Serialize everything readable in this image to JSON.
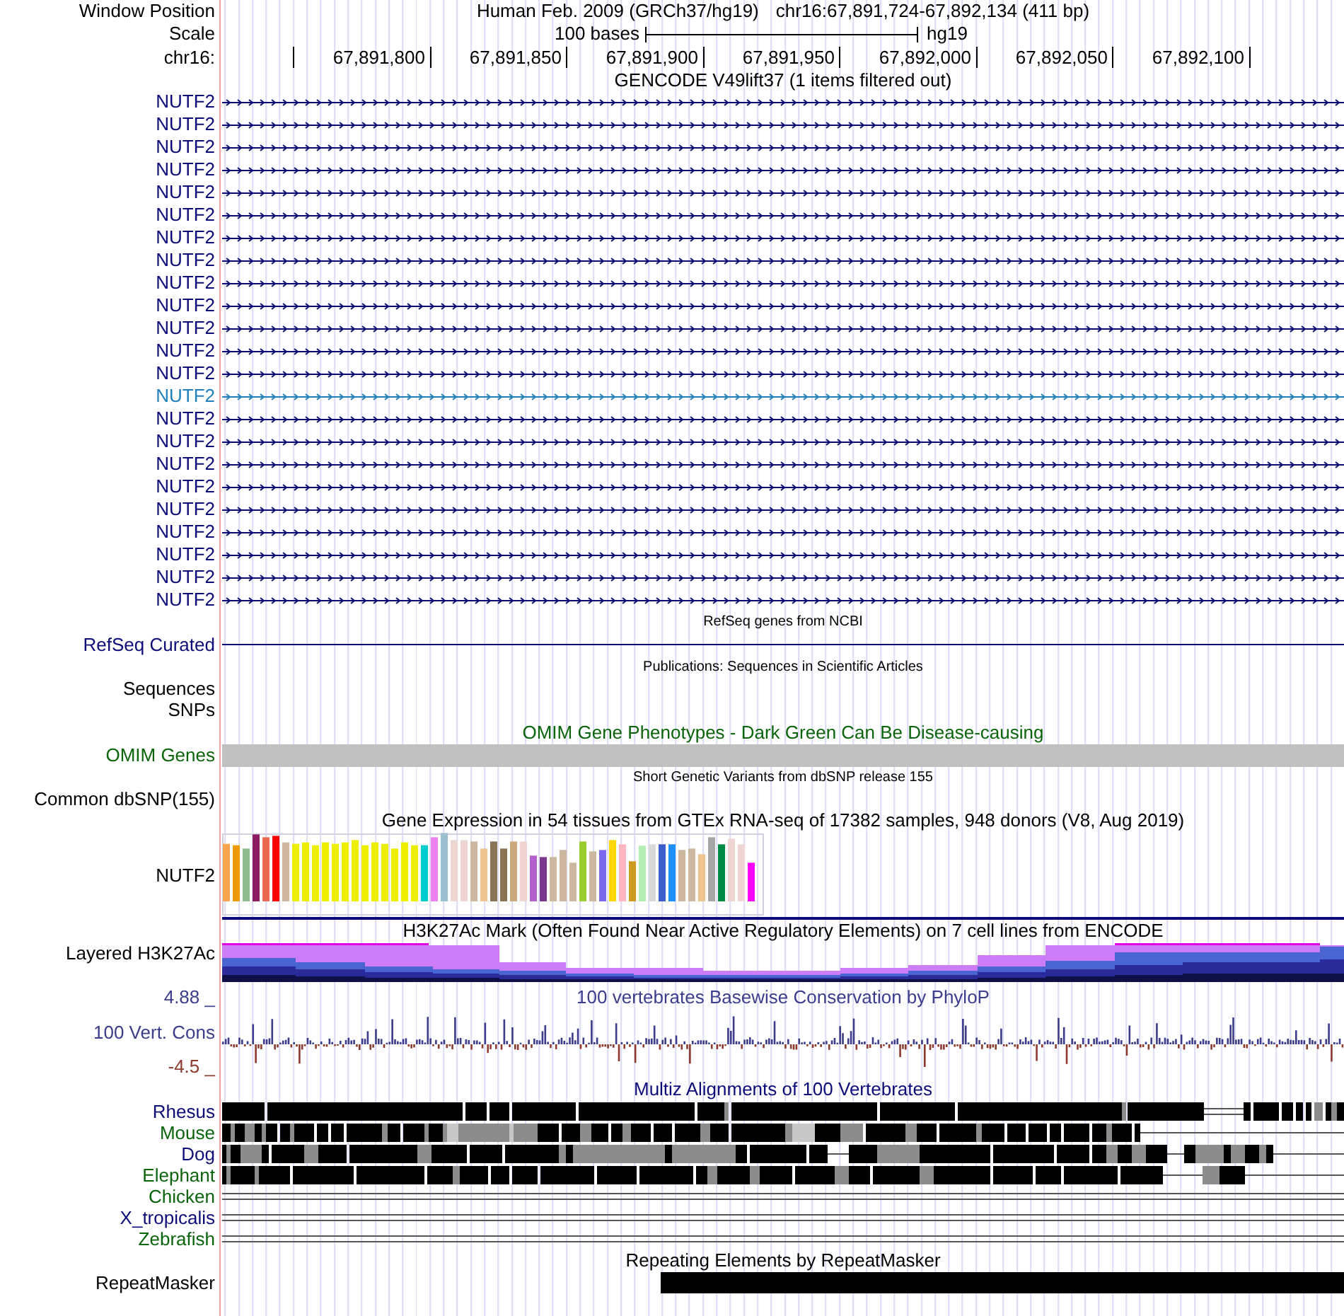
{
  "window_position": {
    "label": "Window Position",
    "assembly": "Human Feb. 2009 (GRCh37/hg19)",
    "position": "chr16:67,891,724-67,892,134 (411 bp)"
  },
  "scale": {
    "label": "Scale",
    "length": "100 bases",
    "assembly": "hg19"
  },
  "ruler": {
    "label": "chr16:",
    "ticks": [
      "67,891,800",
      "67,891,850",
      "67,891,900",
      "67,891,950",
      "67,892,000",
      "67,892,050",
      "67,892,100"
    ]
  },
  "tracks": [
    {
      "kind": "genes",
      "title": "GENCODE V49lift37 (1 items filtered out)",
      "items": [
        {
          "label": "NUTF2",
          "color": "#0c0c78"
        },
        {
          "label": "NUTF2",
          "color": "#0c0c78"
        },
        {
          "label": "NUTF2",
          "color": "#0c0c78"
        },
        {
          "label": "NUTF2",
          "color": "#0c0c78"
        },
        {
          "label": "NUTF2",
          "color": "#0c0c78"
        },
        {
          "label": "NUTF2",
          "color": "#0c0c78"
        },
        {
          "label": "NUTF2",
          "color": "#0c0c78"
        },
        {
          "label": "NUTF2",
          "color": "#0c0c78"
        },
        {
          "label": "NUTF2",
          "color": "#0c0c78"
        },
        {
          "label": "NUTF2",
          "color": "#0c0c78"
        },
        {
          "label": "NUTF2",
          "color": "#0c0c78"
        },
        {
          "label": "NUTF2",
          "color": "#0c0c78"
        },
        {
          "label": "NUTF2",
          "color": "#0c0c78"
        },
        {
          "label": "NUTF2",
          "color": "#1f80bc"
        },
        {
          "label": "NUTF2",
          "color": "#0c0c78"
        },
        {
          "label": "NUTF2",
          "color": "#0c0c78"
        },
        {
          "label": "NUTF2",
          "color": "#0c0c78"
        },
        {
          "label": "NUTF2",
          "color": "#0c0c78"
        },
        {
          "label": "NUTF2",
          "color": "#0c0c78"
        },
        {
          "label": "NUTF2",
          "color": "#0c0c78"
        },
        {
          "label": "NUTF2",
          "color": "#0c0c78"
        },
        {
          "label": "NUTF2",
          "color": "#0c0c78"
        },
        {
          "label": "NUTF2",
          "color": "#0c0c78"
        }
      ]
    },
    {
      "kind": "line",
      "title": "RefSeq genes from NCBI",
      "label": "RefSeq Curated",
      "color": "#0c0c78"
    },
    {
      "kind": "empty",
      "title": "Publications: Sequences in Scientific Articles",
      "labels": [
        "Sequences",
        "SNPs"
      ]
    },
    {
      "kind": "bar",
      "title": "OMIM Gene Phenotypes - Dark Green Can Be Disease-causing",
      "label": "OMIM Genes",
      "color": "#0a640a"
    },
    {
      "kind": "empty",
      "title": "Short Genetic Variants from dbSNP release 155",
      "labels": [
        "Common dbSNP(155)"
      ]
    },
    {
      "kind": "gtex",
      "title": "Gene Expression in 54 tissues from GTEx RNA-seq of 17382 samples, 948 donors (V8, Aug 2019)",
      "label": "NUTF2"
    },
    {
      "kind": "layered",
      "title": "H3K27Ac Mark (Often Found Near Active Regulatory Elements) on 7 cell lines from ENCODE",
      "label": "Layered H3K27Ac"
    },
    {
      "kind": "wiggle",
      "title": "100 vertebrates Basewise Conservation by PhyloP",
      "label": "100 Vert. Cons",
      "max_label": "4.88 _",
      "min_label": "-4.5 _",
      "color": "#3c3c8c"
    },
    {
      "kind": "alignments",
      "title": "Multiz Alignments of 100 Vertebrates",
      "color": "#0c0c78",
      "species": [
        {
          "label": "Rhesus",
          "color": "#0c0c78"
        },
        {
          "label": "Mouse",
          "color": "#0a640a"
        },
        {
          "label": "Dog",
          "color": "#0c0c78"
        },
        {
          "label": "Elephant",
          "color": "#0a640a"
        },
        {
          "label": "Chicken",
          "color": "#0a640a"
        },
        {
          "label": "X_tropicalis",
          "color": "#0c0c78"
        },
        {
          "label": "Zebrafish",
          "color": "#0a640a"
        }
      ]
    },
    {
      "kind": "repeats",
      "title": "Repeating Elements by RepeatMasker",
      "label": "RepeatMasker"
    }
  ]
}
